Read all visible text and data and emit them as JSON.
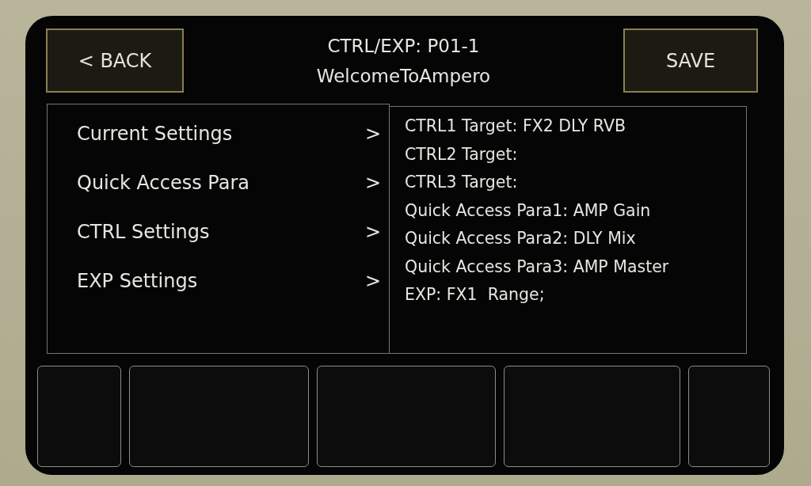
{
  "header": {
    "back_button": "< BACK",
    "title": "CTRL/EXP: P01-1",
    "subtitle": "WelcomeToAmpero",
    "save_button": "SAVE"
  },
  "menu": [
    {
      "label": "Current Settings",
      "arrow": ">"
    },
    {
      "label": "Quick Access Para",
      "arrow": ">"
    },
    {
      "label": "CTRL Settings",
      "arrow": ">"
    },
    {
      "label": "EXP Settings",
      "arrow": ">"
    }
  ],
  "summary": [
    "CTRL1 Target: FX2 DLY RVB",
    "CTRL2 Target:",
    "CTRL3 Target:",
    "Quick Access Para1: AMP Gain",
    "Quick Access Para2: DLY Mix",
    "Quick Access Para3: AMP Master",
    "EXP: FX1  Range;"
  ]
}
